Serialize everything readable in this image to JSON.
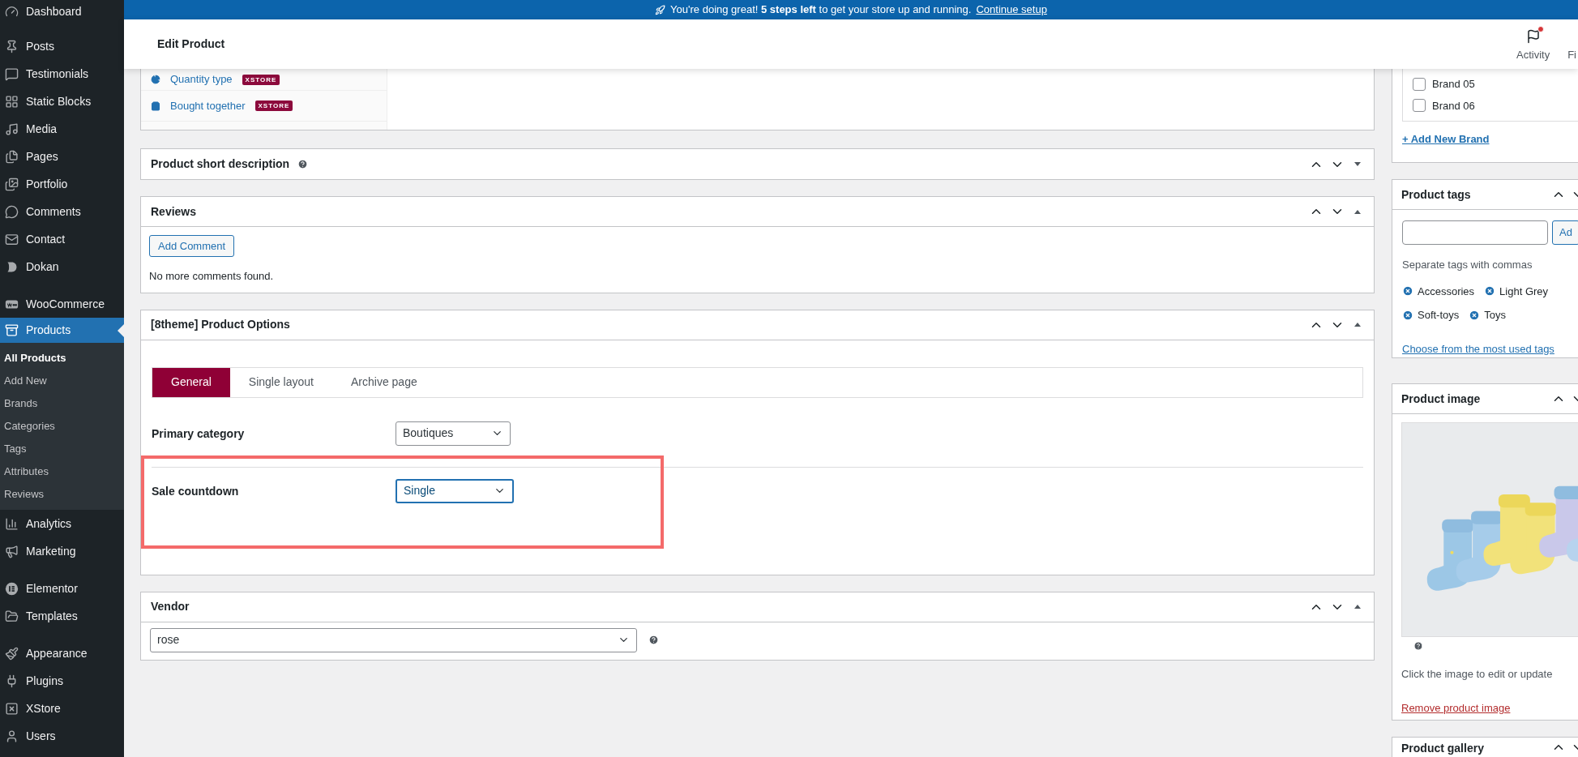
{
  "sidebar": {
    "groups": [
      {
        "items": [
          {
            "label": "Dashboard",
            "selected": false
          }
        ]
      },
      {
        "items": [
          {
            "label": "Posts",
            "selected": false
          },
          {
            "label": "Testimonials",
            "selected": false
          },
          {
            "label": "Static Blocks",
            "selected": false
          },
          {
            "label": "Media",
            "selected": false
          },
          {
            "label": "Pages",
            "selected": false
          },
          {
            "label": "Portfolio",
            "selected": false
          },
          {
            "label": "Comments",
            "selected": false
          },
          {
            "label": "Contact",
            "selected": false
          },
          {
            "label": "Dokan",
            "selected": false
          }
        ]
      },
      {
        "items": [
          {
            "label": "WooCommerce",
            "selected": false
          },
          {
            "label": "Products",
            "selected": true,
            "children": [
              {
                "label": "All Products",
                "selected": true
              },
              {
                "label": "Add New",
                "selected": false
              },
              {
                "label": "Brands",
                "selected": false
              },
              {
                "label": "Categories",
                "selected": false
              },
              {
                "label": "Tags",
                "selected": false
              },
              {
                "label": "Attributes",
                "selected": false
              },
              {
                "label": "Reviews",
                "selected": false
              }
            ]
          },
          {
            "label": "Analytics",
            "selected": false
          },
          {
            "label": "Marketing",
            "selected": false
          }
        ]
      },
      {
        "items": [
          {
            "label": "Elementor",
            "selected": false
          },
          {
            "label": "Templates",
            "selected": false
          }
        ]
      },
      {
        "items": [
          {
            "label": "Appearance",
            "selected": false
          },
          {
            "label": "Plugins",
            "selected": false
          },
          {
            "label": "XStore",
            "selected": false
          },
          {
            "label": "Users",
            "selected": false
          }
        ]
      }
    ]
  },
  "banner": {
    "text": "You're doing great! **5 steps left** to get your store up and running.",
    "link": "Continue setup"
  },
  "header": {
    "title": "Edit Product",
    "actions": [
      {
        "label": "Activity",
        "notification": true
      },
      {
        "label": "Fi"
      }
    ]
  },
  "product_data": {
    "tabs": [
      {
        "label": "Quantity type",
        "badge": "XSTORE"
      },
      {
        "label": "Bought together",
        "badge": "XSTORE"
      }
    ]
  },
  "panels": [
    {
      "title": "Product short description",
      "help": true,
      "expanded": false
    },
    {
      "kind": "reviews",
      "title": "Reviews",
      "expanded": true,
      "button": "Add Comment",
      "message": "No more comments found."
    },
    {
      "kind": "options",
      "title": "[8theme] Product Options",
      "expanded": true,
      "tabs": [
        {
          "label": "General",
          "selected": true
        },
        {
          "label": "Single layout",
          "selected": false
        },
        {
          "label": "Archive page",
          "selected": false
        }
      ],
      "fields": [
        {
          "label": "Primary category",
          "value": "Boutiques",
          "focused": false
        },
        {
          "label": "Sale countdown",
          "value": "Single",
          "focused": true,
          "highlighted": true
        }
      ]
    },
    {
      "kind": "vendor",
      "title": "Vendor",
      "expanded": true,
      "value": "rose",
      "field_help": true
    }
  ],
  "brands": {
    "items": [
      {
        "label": "Brand 05",
        "checked": false
      },
      {
        "label": "Brand 06",
        "checked": false
      }
    ],
    "link": "+ Add New Brand"
  },
  "tags_box": {
    "title": "Product tags",
    "button": "Ad",
    "hint": "Separate tags with commas",
    "tags": [
      "Accessories",
      "Light Grey",
      "Soft-toys",
      "Toys"
    ],
    "link": "Choose from the most used tags"
  },
  "image_box": {
    "title": "Product image",
    "caption": "Click the image to edit or update",
    "link": "Remove product image"
  },
  "gallery_box": {
    "title": "Product gallery"
  }
}
